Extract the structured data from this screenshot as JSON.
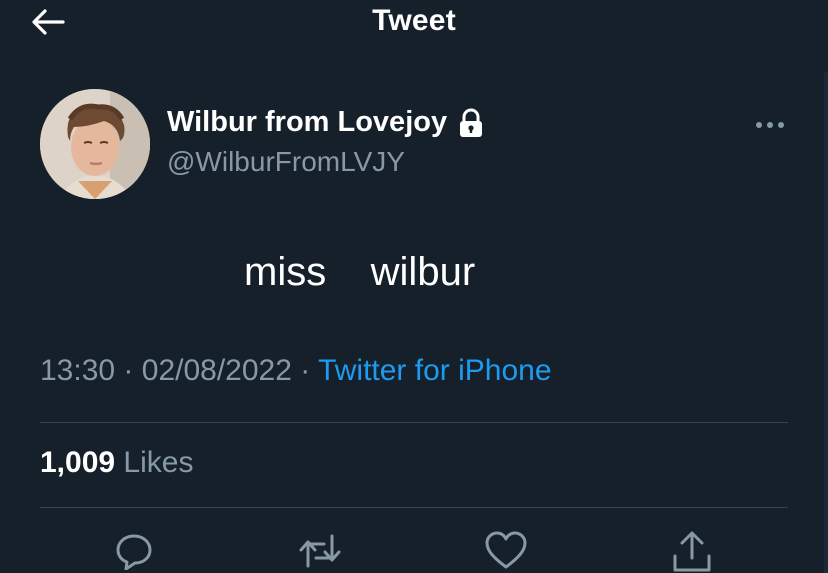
{
  "header": {
    "title": "Tweet",
    "back_icon": "arrow-left-icon"
  },
  "author": {
    "display_name": "Wilbur from Lovejoy",
    "handle": "@WilburFromLVJY",
    "protected_icon": "lock-icon"
  },
  "tweet": {
    "text": "miss    wilbur"
  },
  "meta": {
    "time": "13:30",
    "separator": "·",
    "date": "02/08/2022",
    "source": "Twitter for iPhone"
  },
  "stats": {
    "likes_count": "1,009",
    "likes_label": "Likes"
  },
  "actions": [
    "reply-icon",
    "retweet-icon",
    "like-icon",
    "share-icon"
  ],
  "colors": {
    "background": "#15202b",
    "text": "#ffffff",
    "secondary": "#8899a6",
    "accent": "#1d9bf0",
    "divider": "#38444d"
  }
}
